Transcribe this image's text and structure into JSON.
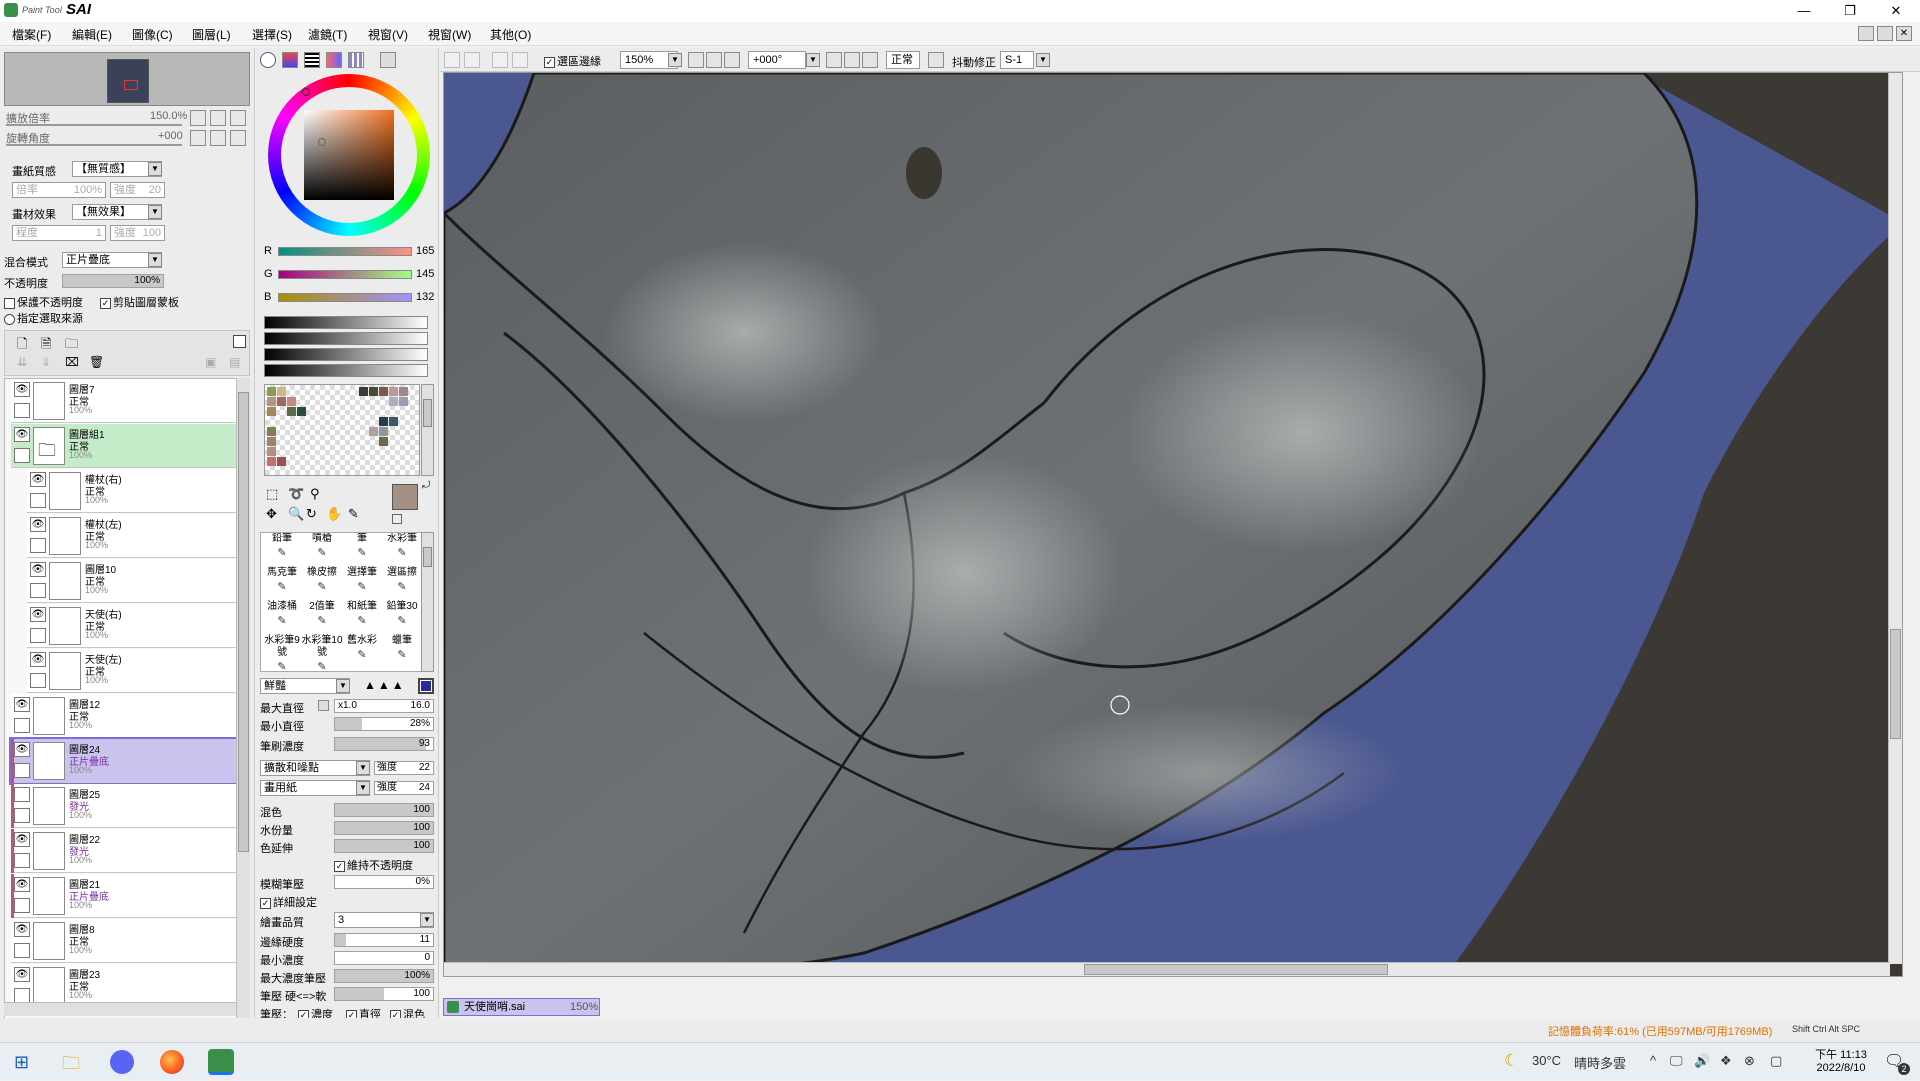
{
  "window": {
    "app_logo_text": "Paint Tool",
    "app_logo_brand": "SAI"
  },
  "menu": [
    "檔案(F)",
    "編輯(E)",
    "圖像(C)",
    "圖層(L)",
    "選擇(S)",
    "濾鏡(T)",
    "視窗(V)",
    "視窗(W)",
    "其他(O)"
  ],
  "navigator": {
    "zoom_label": "擴放倍率",
    "zoom_value": "150.0%",
    "rotate_label": "旋轉角度",
    "rotate_value": "+000"
  },
  "paper": {
    "texture_label": "畫紙質感",
    "texture_value": "【無質感】",
    "tex_scale_label": "倍率",
    "tex_scale_value": "100%",
    "tex_strength_label": "強度",
    "tex_strength_value": "20",
    "effect_label": "畫材效果",
    "effect_value": "【無效果】",
    "effect_degree_label": "程度",
    "effect_degree_value": "1",
    "effect_strength_label": "強度",
    "effect_strength_value": "100"
  },
  "layer_props": {
    "blend_label": "混合模式",
    "blend_value": "正片疊底",
    "opacity_label": "不透明度",
    "opacity_value": "100%",
    "opacity_fraction": 1.0,
    "preserve_opacity": "保護不透明度",
    "clip_group": "剪貼圖層蒙板",
    "selection_source": "指定選取來源"
  },
  "layers": [
    {
      "name": "圖層7",
      "mode": "正常",
      "opacity": "100%",
      "visible": true,
      "indent": false,
      "type": "layer"
    },
    {
      "name": "圖層組1",
      "mode": "正常",
      "opacity": "100%",
      "visible": true,
      "indent": false,
      "type": "group"
    },
    {
      "name": "權杖(右)",
      "mode": "正常",
      "opacity": "100%",
      "visible": true,
      "indent": true,
      "type": "layer"
    },
    {
      "name": "權杖(左)",
      "mode": "正常",
      "opacity": "100%",
      "visible": true,
      "indent": true,
      "type": "layer"
    },
    {
      "name": "圖層10",
      "mode": "正常",
      "opacity": "100%",
      "visible": true,
      "indent": true,
      "type": "layer"
    },
    {
      "name": "天使(右)",
      "mode": "正常",
      "opacity": "100%",
      "visible": true,
      "indent": true,
      "type": "layer"
    },
    {
      "name": "天使(左)",
      "mode": "正常",
      "opacity": "100%",
      "visible": true,
      "indent": true,
      "type": "layer"
    },
    {
      "name": "圖層12",
      "mode": "正常",
      "opacity": "100%",
      "visible": true,
      "indent": false,
      "type": "layer"
    },
    {
      "name": "圖層24",
      "mode": "正片疊底",
      "opacity": "100%",
      "visible": true,
      "indent": false,
      "type": "selected"
    },
    {
      "name": "圖層25",
      "mode": "發光",
      "opacity": "100%",
      "visible": false,
      "indent": false,
      "type": "clip"
    },
    {
      "name": "圖層22",
      "mode": "發光",
      "opacity": "100%",
      "visible": true,
      "indent": false,
      "type": "clip"
    },
    {
      "name": "圖層21",
      "mode": "正片疊底",
      "opacity": "100%",
      "visible": true,
      "indent": false,
      "type": "clip"
    },
    {
      "name": "圖層8",
      "mode": "正常",
      "opacity": "100%",
      "visible": true,
      "indent": false,
      "type": "layer"
    },
    {
      "name": "圖層23",
      "mode": "正常",
      "opacity": "100%",
      "visible": true,
      "indent": false,
      "type": "layer"
    }
  ],
  "color": {
    "r_label": "R",
    "r_value": "165",
    "g_label": "G",
    "g_value": "145",
    "b_label": "B",
    "b_value": "132",
    "current_hex": "#a59184"
  },
  "brushes": [
    [
      "鉛筆",
      "噴槍",
      "筆",
      "水彩筆"
    ],
    [
      "馬克筆",
      "橡皮擦",
      "選擇筆",
      "選區擦"
    ],
    [
      "油漆桶",
      "2值筆",
      "和紙筆",
      "鉛筆30"
    ],
    [
      "水彩筆9號",
      "水彩筆10號",
      "舊水彩",
      "蠟筆"
    ]
  ],
  "brush_settings": {
    "shape_value": "鮮豔",
    "max_size_label": "最大直徑",
    "max_size_mult": "x1.0",
    "max_size_value": "16.0",
    "min_size_label": "最小直徑",
    "min_size_value": "28%",
    "density_label": "筆刷濃度",
    "density_value": "93",
    "shape_type": "擴散和噪點",
    "shape_strength_label": "強度",
    "shape_strength_value": "22",
    "texture_type": "畫用紙",
    "texture_strength_label": "強度",
    "texture_strength_value": "24",
    "blend_label": "混色",
    "blend_value": "100",
    "water_label": "水份量",
    "water_value": "100",
    "stretch_label": "色延伸",
    "stretch_value": "100",
    "keep_opacity": "維持不透明度",
    "blur_label": "模糊筆壓",
    "blur_value": "0%",
    "detail_label": "詳細設定",
    "quality_label": "繪畫品質",
    "quality_value": "3",
    "edge_label": "邊緣硬度",
    "edge_value": "11",
    "min_density_label": "最小濃度",
    "min_density_value": "0",
    "max_density_pressure_label": "最大濃度筆壓",
    "max_density_pressure_value": "100%",
    "pressure_hardness_label": "筆壓 硬<=>軟",
    "pressure_hardness_value": "100",
    "pressure_label": "筆壓：",
    "pressure_density": "濃度",
    "pressure_size": "直徑",
    "pressure_blend": "混色"
  },
  "toolbar": {
    "selection_edge": "選區邊緣",
    "zoom": "150%",
    "angle": "+000°",
    "mode": "正常",
    "stabilizer_label": "抖動修正",
    "stabilizer_value": "S-1"
  },
  "document_tab": {
    "name": "天使崗哨.sai",
    "zoom": "150%"
  },
  "status": {
    "memory": "記憶體負荷率:61% (已用597MB/可用1769MB)",
    "keys": "Shift Ctrl Alt SPC"
  },
  "taskbar": {
    "weather_temp": "30°C",
    "weather_text": "晴時多雲",
    "time": "下午 11:13",
    "date": "2022/8/10",
    "notification_count": "2"
  }
}
